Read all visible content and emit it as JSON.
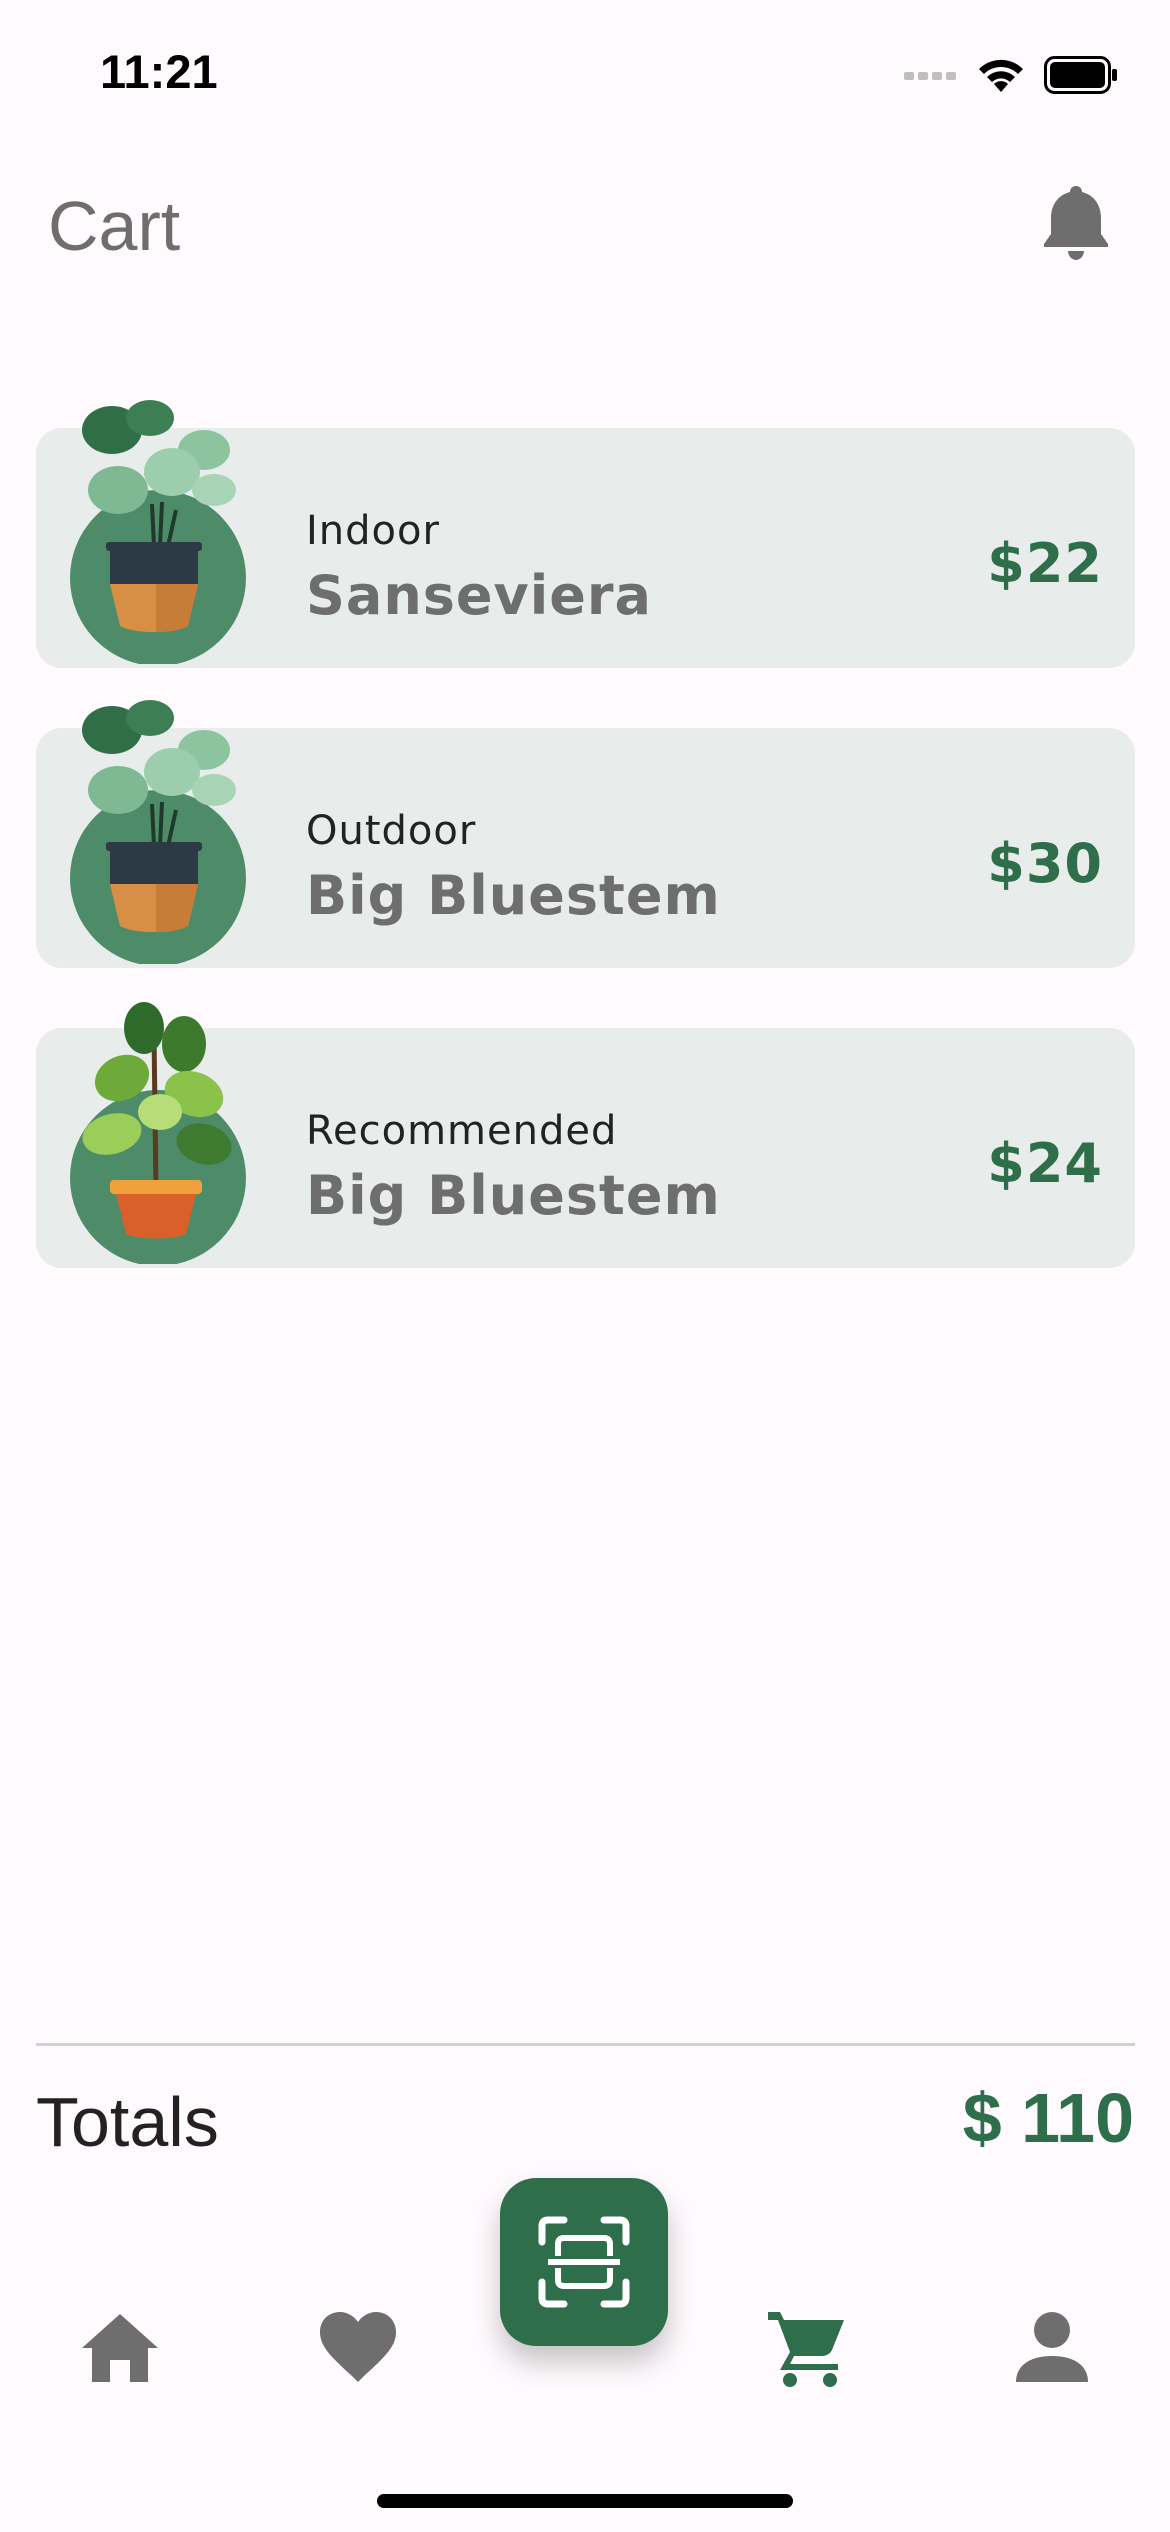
{
  "status_bar": {
    "time": "11:21"
  },
  "header": {
    "title": "Cart"
  },
  "cart": {
    "items": [
      {
        "category": "Indoor",
        "name": "Sanseviera",
        "price": "$22",
        "plant_icon": "potted-plant-icon"
      },
      {
        "category": "Outdoor",
        "name": "Big Bluestem",
        "price": "$30",
        "plant_icon": "potted-plant-icon"
      },
      {
        "category": "Recommended",
        "name": "Big Bluestem",
        "price": "$24",
        "plant_icon": "fiddle-leaf-plant-icon"
      }
    ]
  },
  "totals": {
    "label": "Totals",
    "value": "$ 110"
  },
  "nav": {
    "items": [
      "home-icon",
      "heart-icon",
      "scan-icon",
      "cart-icon",
      "profile-icon"
    ],
    "active": "cart-icon"
  },
  "colors": {
    "accent": "#2E6E4A",
    "card_bg": "#E8ECEA",
    "muted_text": "#6E6E6E",
    "background": "#FFFAFD"
  }
}
